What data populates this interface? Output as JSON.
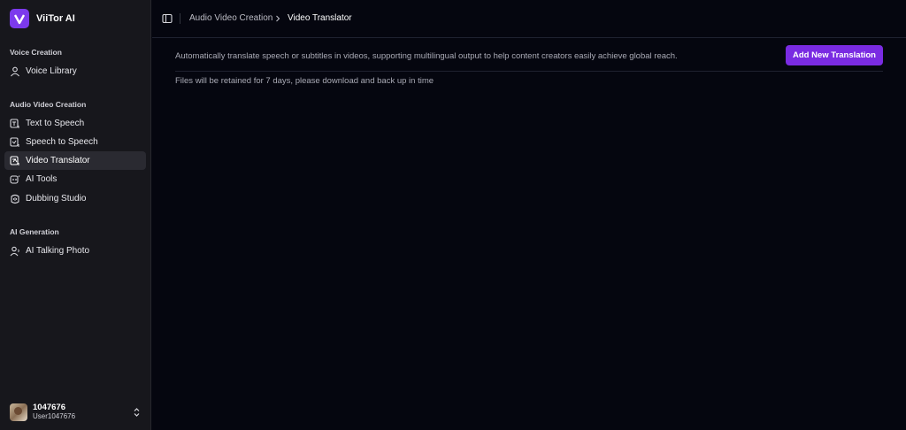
{
  "brand": {
    "name": "ViiTor AI",
    "logo_letter": "V",
    "accent": "#7c3aed"
  },
  "sidebar": {
    "sections": [
      {
        "title": "Voice Creation",
        "items": [
          {
            "label": "Voice Library",
            "icon": "voice-library-icon"
          }
        ]
      },
      {
        "title": "Audio Video Creation",
        "items": [
          {
            "label": "Text to Speech",
            "icon": "text-to-speech-icon"
          },
          {
            "label": "Speech to Speech",
            "icon": "speech-to-speech-icon"
          },
          {
            "label": "Video Translator",
            "icon": "video-translator-icon",
            "active": true
          },
          {
            "label": "AI Tools",
            "icon": "ai-tools-icon"
          },
          {
            "label": "Dubbing Studio",
            "icon": "dubbing-studio-icon"
          }
        ]
      },
      {
        "title": "AI Generation",
        "items": [
          {
            "label": "AI Talking Photo",
            "icon": "talking-photo-icon"
          }
        ]
      }
    ]
  },
  "user": {
    "name": "1047676",
    "username": "User1047676"
  },
  "breadcrumb": {
    "parent": "Audio Video Creation",
    "current": "Video Translator"
  },
  "main": {
    "description": "Automatically translate speech or subtitles in videos, supporting multilingual output to help content creators easily achieve global reach.",
    "add_button": "Add New Translation",
    "retention_note": "Files will be retained for 7 days, please download and back up in time"
  },
  "colors": {
    "background": "#05060f",
    "sidebar": "#17171c",
    "button": "#7a2be2"
  }
}
